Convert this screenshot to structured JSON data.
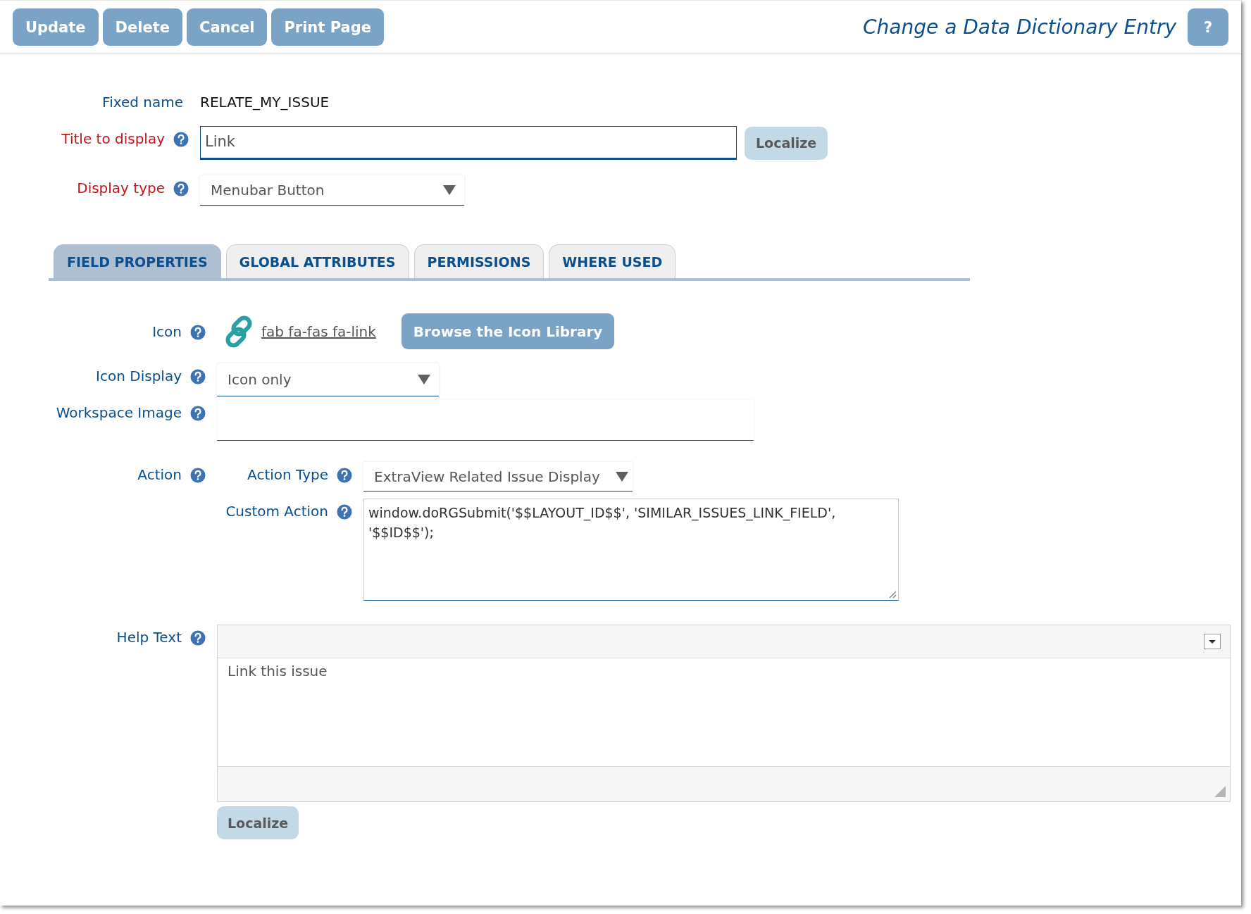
{
  "toolbar": {
    "buttons": [
      "Update",
      "Delete",
      "Cancel",
      "Print Page"
    ],
    "title": "Change a Data Dictionary Entry",
    "help_button": "?"
  },
  "header_fields": [
    {
      "kind": "text",
      "label": "Fixed name",
      "required": false,
      "help": false,
      "value": "RELATE_MY_ISSUE"
    },
    {
      "kind": "input",
      "label": "Title to display",
      "required": true,
      "help": true,
      "value": "Link",
      "button": "Localize"
    },
    {
      "kind": "select",
      "label": "Display type",
      "required": true,
      "help": true,
      "value": "Menubar Button"
    }
  ],
  "tabs": [
    {
      "label": "FIELD PROPERTIES",
      "selected": true
    },
    {
      "label": "GLOBAL ATTRIBUTES",
      "selected": false
    },
    {
      "label": "PERMISSIONS",
      "selected": false
    },
    {
      "label": "WHERE USED",
      "selected": false
    }
  ],
  "properties": [
    {
      "kind": "icon",
      "label": "Icon",
      "help": true,
      "value": "fab fa-fas fa-link",
      "button": "Browse the Icon Library"
    },
    {
      "kind": "select",
      "label": "Icon Display",
      "help": true,
      "value": "Icon only"
    },
    {
      "kind": "input",
      "label": "Workspace Image",
      "help": true
    },
    {
      "kind": "group",
      "label": "Action",
      "help": true,
      "fields": [
        {
          "kind": "select",
          "label": "Action Type",
          "help": true,
          "value": "ExtraView Related Issue Display"
        },
        {
          "kind": "textarea",
          "label": "Custom Action",
          "help": true,
          "value": "window.doRGSubmit('$$LAYOUT_ID$$', 'SIMILAR_ISSUES_LINK_FIELD', '$$ID$$');"
        }
      ]
    },
    {
      "kind": "editor",
      "label": "Help Text",
      "help": true,
      "value": "Link this issue",
      "button": "Localize"
    }
  ]
}
